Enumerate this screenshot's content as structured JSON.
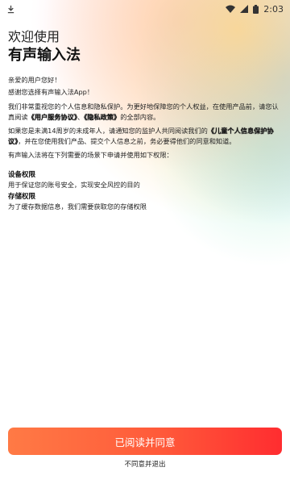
{
  "status_bar": {
    "left_icon": "download-icon",
    "time": "2:03",
    "icons": [
      "wifi-icon",
      "signal-icon",
      "battery-icon"
    ]
  },
  "header": {
    "welcome": "欢迎使用",
    "app_name": "有声输入法"
  },
  "body": {
    "greeting": "亲爱的用户您好！",
    "thanks": "感谢您选择有声输入法App！",
    "main_intro": "我们非常重视您的个人信息和隐私保护。为更好地保障您的个人权益，在使用产品前，请您认真阅读",
    "link_user_agreement": "《用户服务协议》",
    "separator": "、",
    "link_privacy_policy": "《隐私政策》",
    "main_outro": "的全部内容。",
    "minor_intro": "如果您是未满14周岁的未成年人，请通知您的监护人共同阅读我们的",
    "link_child_policy": "《儿童个人信息保护协议》",
    "minor_outro": "，并在您使用我们产品、提交个人信息之前，务必要得他们的同意和知道。",
    "permissions_lead": "有声输入法将在下列需要的场景下申请并使用如下权限："
  },
  "permissions": [
    {
      "title": "设备权限",
      "desc": "用于保证您的账号安全，实现安全风控的目的"
    },
    {
      "title": "存储权限",
      "desc": "为了缓存数据信息，我们需要获取您的存储权限"
    }
  ],
  "actions": {
    "agree_label": "已阅读并同意",
    "disagree_label": "不同意并退出"
  },
  "colors": {
    "agree_gradient_start": "#ff7a45",
    "agree_gradient_end": "#ff2d30"
  }
}
